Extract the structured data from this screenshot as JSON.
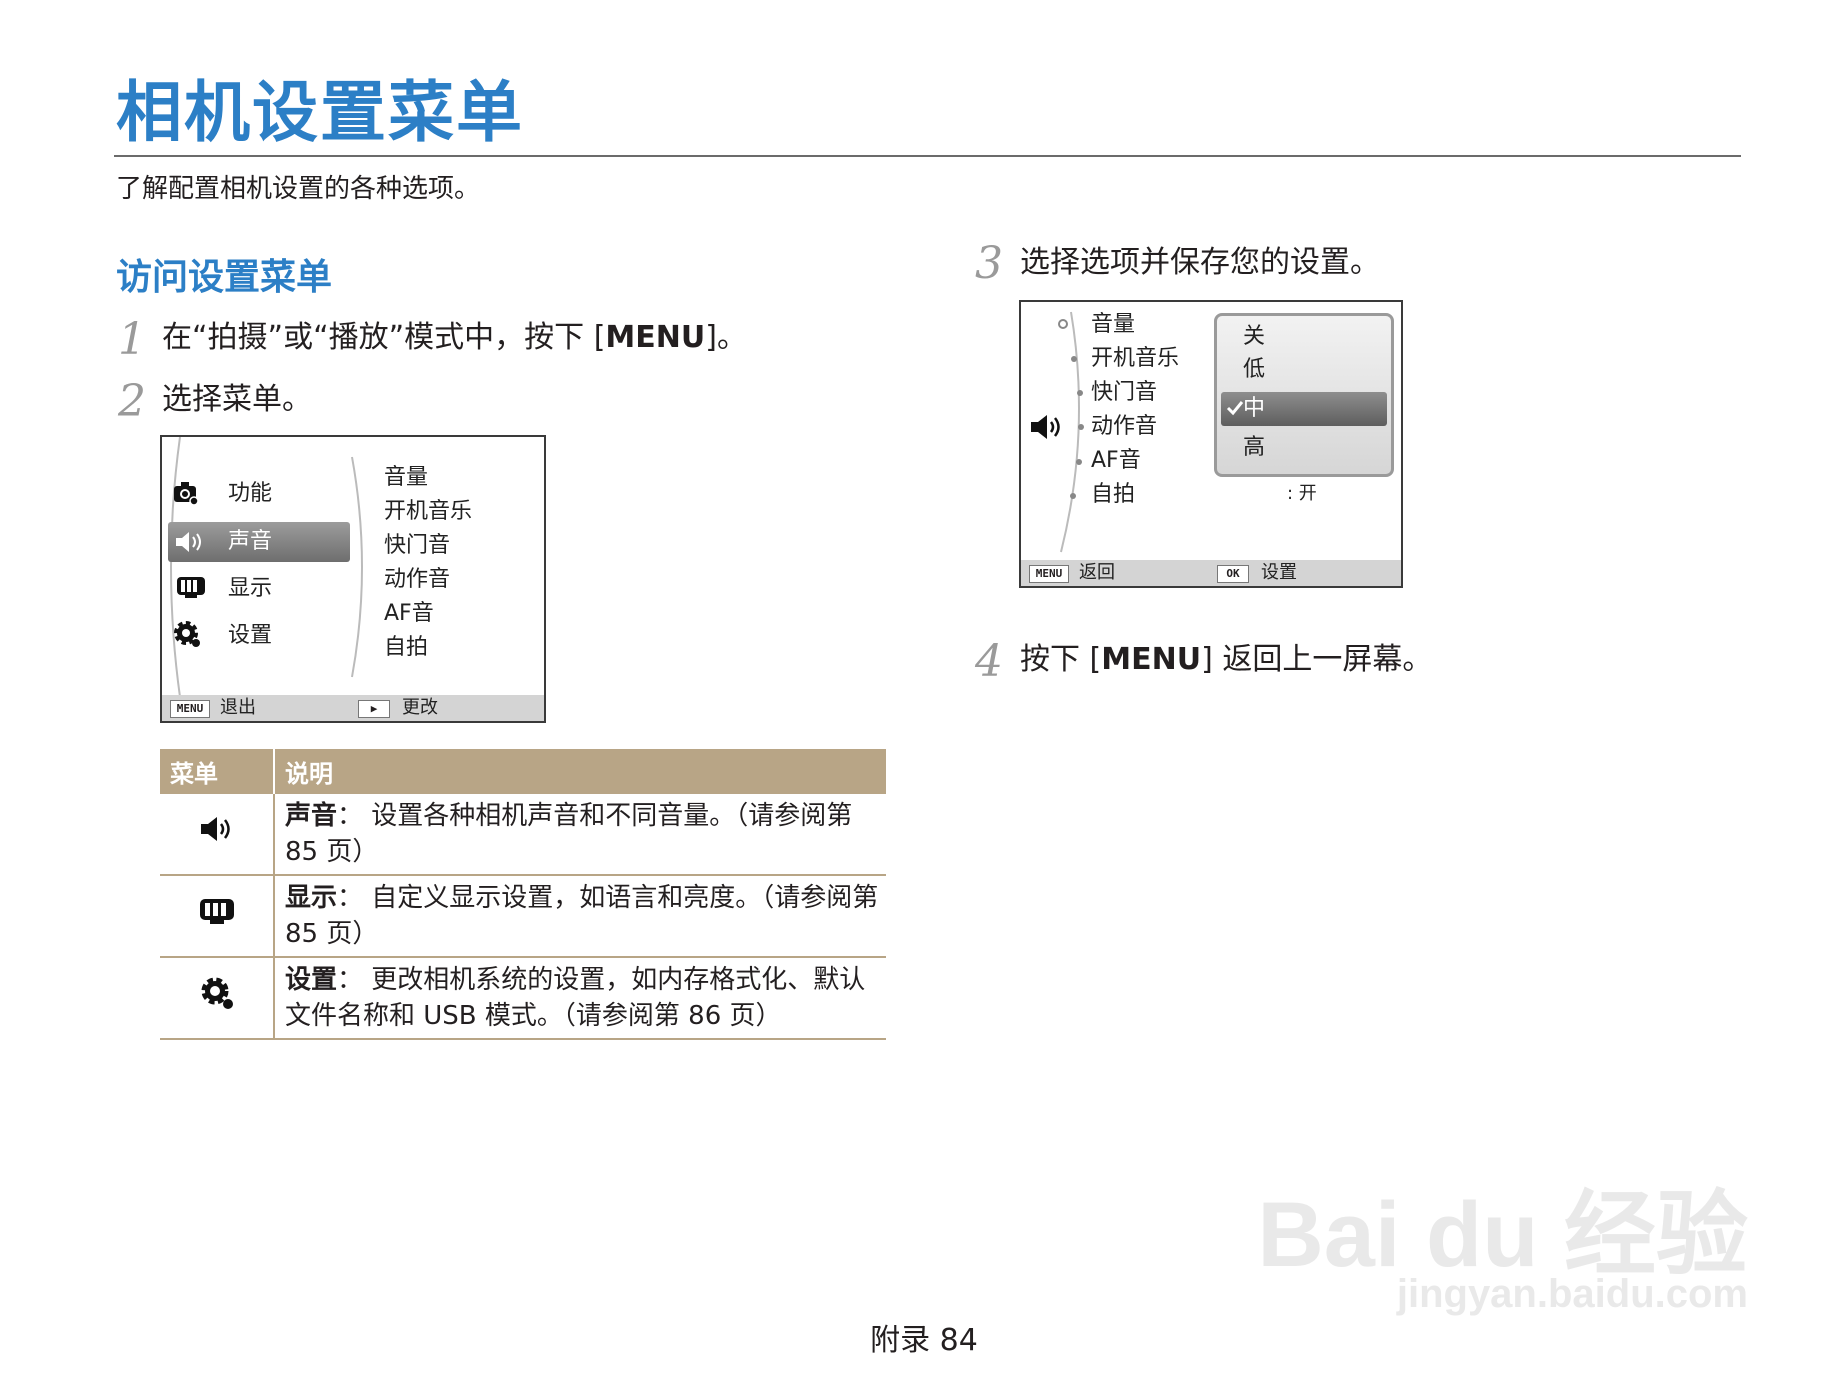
{
  "header": {
    "title": "相机设置菜单",
    "subtitle": "了解配置相机设置的各种选项。"
  },
  "section": {
    "title": "访问设置菜单"
  },
  "steps": [
    {
      "num": "1",
      "pre": "在“拍摄”或“播放”模式中，按下 [",
      "key": "MENU",
      "post": "]。"
    },
    {
      "num": "2",
      "text": "选择菜单。"
    },
    {
      "num": "3",
      "text": "选择选项并保存您的设置。"
    },
    {
      "num": "4",
      "pre": "按下 [",
      "key": "MENU",
      "post": "] 返回上一屏幕。"
    }
  ],
  "screen1": {
    "menu": [
      {
        "label": "功能",
        "icon": "camera-settings-icon",
        "selected": false
      },
      {
        "label": "声音",
        "icon": "speaker-icon",
        "selected": true
      },
      {
        "label": "显示",
        "icon": "display-icon",
        "selected": false
      },
      {
        "label": "设置",
        "icon": "gear-icon",
        "selected": false
      }
    ],
    "submenu": [
      "音量",
      "开机音乐",
      "快门音",
      "动作音",
      "AF音",
      "自拍"
    ],
    "bar": {
      "left_key": "MENU",
      "left_label": "退出",
      "right_key": "▶",
      "right_label": "更改"
    }
  },
  "screen2": {
    "submenu": [
      "音量",
      "开机音乐",
      "快门音",
      "动作音",
      "AF音",
      "自拍"
    ],
    "options": [
      "关",
      "低",
      "中",
      "高"
    ],
    "selected_option": "中",
    "value_label": ": 开",
    "bar": {
      "left_key": "MENU",
      "left_label": "返回",
      "right_key": "OK",
      "right_label": "设置"
    }
  },
  "table": {
    "headers": [
      "菜单",
      "说明"
    ],
    "rows": [
      {
        "icon": "speaker-icon",
        "title": "声音",
        "colon": "：",
        "desc": "设置各种相机声音和不同音量。（请参阅第 85 页）"
      },
      {
        "icon": "display-icon",
        "title": "显示",
        "colon": "：",
        "desc": "自定义显示设置，如语言和亮度。（请参阅第 85 页）"
      },
      {
        "icon": "gear-icon",
        "title": "设置",
        "colon": "：",
        "desc": "更改相机系统的设置，如内存格式化、默认文件名称和 USB 模式。（请参阅第 86 页）"
      }
    ]
  },
  "footer": {
    "page": "附录 84"
  },
  "watermark": {
    "line1": "Bai du 经验",
    "line2": "jingyan.baidu.com"
  },
  "colors": {
    "accent": "#2c7fc6",
    "table_header": "#b8a586",
    "step_num": "#9a9a9a"
  }
}
